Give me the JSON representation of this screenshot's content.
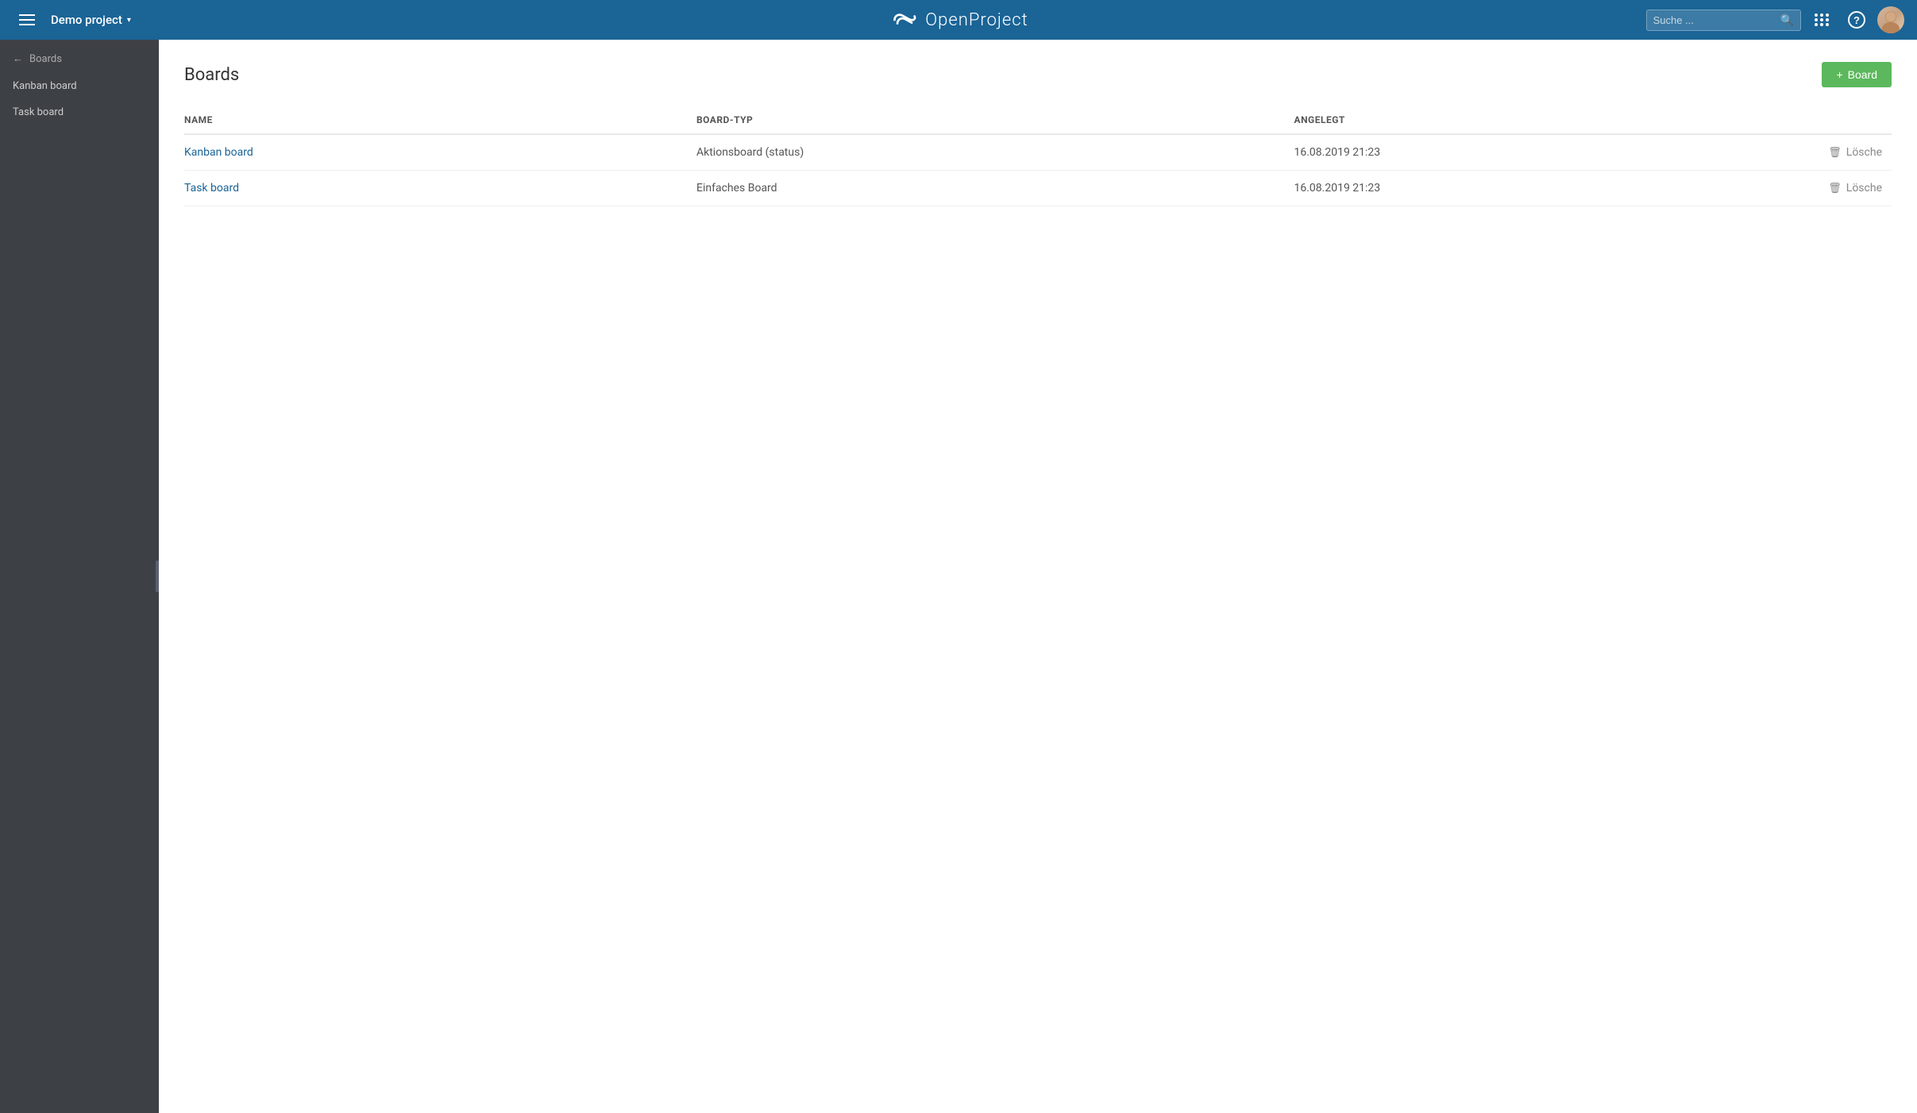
{
  "topNav": {
    "menuLabel": "Menu",
    "projectName": "Demo project",
    "logoText": "OpenProject",
    "search": {
      "placeholder": "Suche ..."
    },
    "addBoardButton": "+ Board"
  },
  "sidebar": {
    "backLabel": "Boards",
    "items": [
      {
        "id": "kanban-board",
        "label": "Kanban board"
      },
      {
        "id": "task-board",
        "label": "Task board"
      }
    ]
  },
  "page": {
    "title": "Boards",
    "addButtonLabel": "+ Board",
    "table": {
      "columns": [
        {
          "id": "name",
          "label": "NAME"
        },
        {
          "id": "type",
          "label": "BOARD-TYP"
        },
        {
          "id": "created",
          "label": "ANGELEGT"
        }
      ],
      "rows": [
        {
          "id": "kanban-board",
          "name": "Kanban board",
          "type": "Aktionsboard (status)",
          "created": "16.08.2019 21:23",
          "deleteLabel": "Lösche"
        },
        {
          "id": "task-board",
          "name": "Task board",
          "type": "Einfaches Board",
          "created": "16.08.2019 21:23",
          "deleteLabel": "Lösche"
        }
      ]
    }
  }
}
